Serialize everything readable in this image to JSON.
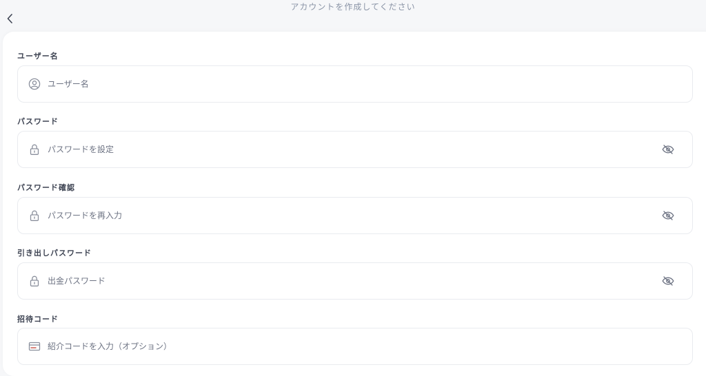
{
  "header": {
    "title": "アカウントを作成してください",
    "back_icon": "chevron-left-icon"
  },
  "form": {
    "fields": [
      {
        "label": "ユーザー名",
        "placeholder": "ユーザー名",
        "icon": "user-circle-icon"
      },
      {
        "label": "パスワード",
        "placeholder": "パスワードを設定",
        "icon": "lock-icon",
        "toggle_icon": "eye-off-icon"
      },
      {
        "label": "パスワード確認",
        "placeholder": "パスワードを再入力",
        "icon": "lock-icon",
        "toggle_icon": "eye-off-icon"
      },
      {
        "label": "引き出しパスワード",
        "placeholder": "出金パスワード",
        "icon": "lock-icon",
        "toggle_icon": "eye-off-icon"
      },
      {
        "label": "招待コード",
        "placeholder": "紹介コードを入力（オプション）",
        "icon": "card-icon"
      }
    ]
  },
  "colors": {
    "background": "#f6f7f9",
    "card": "#ffffff",
    "border": "#e9ebef",
    "label": "#3d4352",
    "placeholder": "#6d7383",
    "icon": "#8a8f9c",
    "invite_icon_accent": "#c0392b"
  }
}
